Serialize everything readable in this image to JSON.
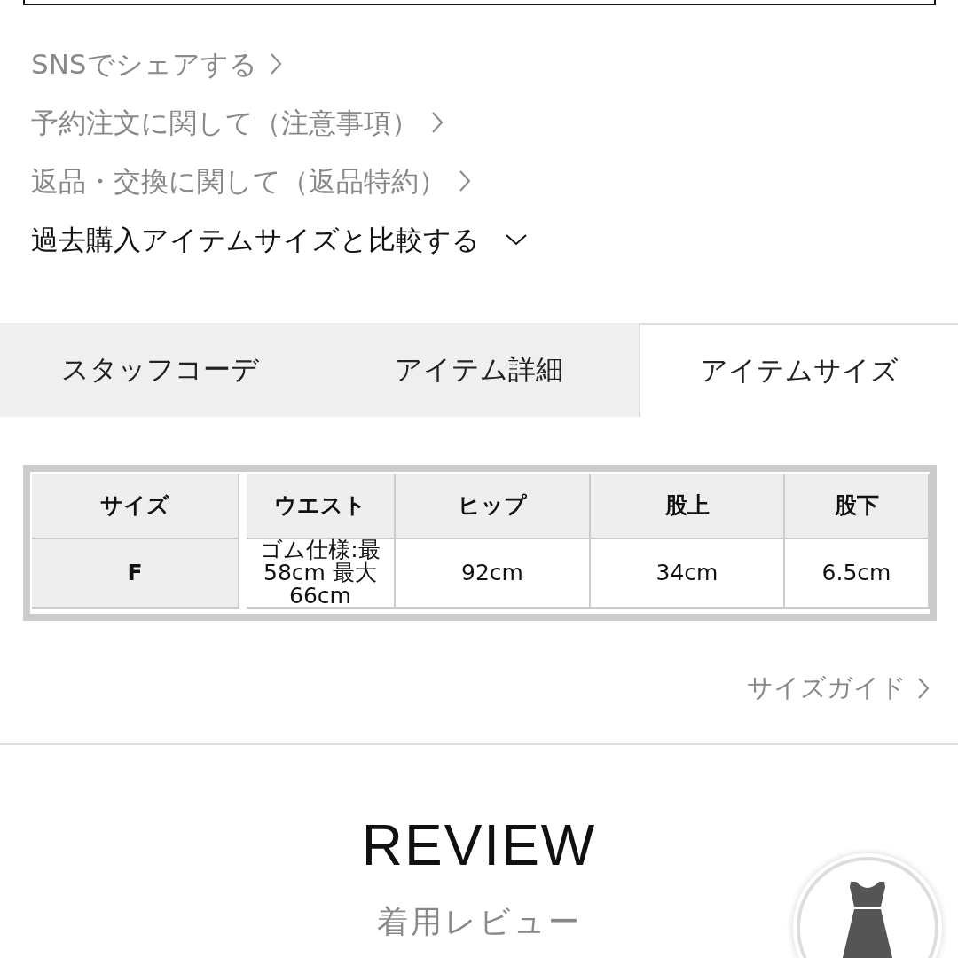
{
  "links": [
    {
      "label": "SNSでシェアする",
      "kind": "more"
    },
    {
      "label": "予約注文に関して（注意事項）",
      "kind": "more"
    },
    {
      "label": "返品・交換に関して（返品特約）",
      "kind": "more"
    },
    {
      "label": "過去購入アイテムサイズと比較する",
      "kind": "expand"
    }
  ],
  "tabs": [
    {
      "label": "スタッフコーデ",
      "selected": false
    },
    {
      "label": "アイテム詳細",
      "selected": false
    },
    {
      "label": "アイテムサイズ",
      "selected": true
    }
  ],
  "size_table": {
    "columns": [
      "サイズ",
      "ウエスト",
      "ヒップ",
      "股上",
      "股下"
    ],
    "rows": [
      [
        "F",
        "ゴム仕様:最\n58cm 最大\n66cm",
        "92cm",
        "34cm",
        "6.5cm"
      ]
    ]
  },
  "size_guide": "サイズガイド",
  "review": {
    "title": "REVIEW",
    "subtitle": "着用レビュー"
  }
}
